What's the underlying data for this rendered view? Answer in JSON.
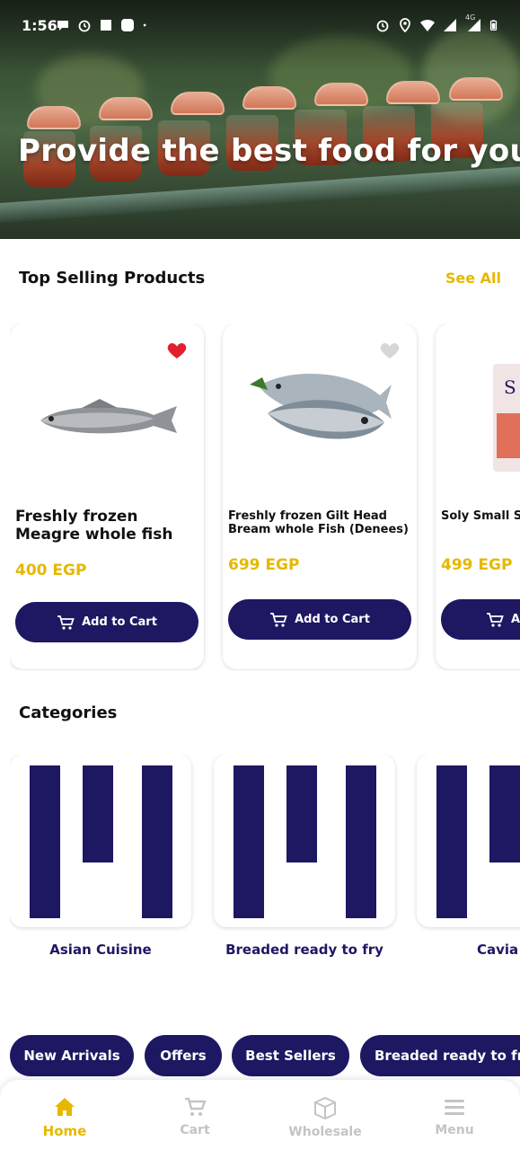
{
  "status_bar": {
    "time": "1:56",
    "network": "4G"
  },
  "hero": {
    "title": "Provide the best food for you"
  },
  "top_selling": {
    "title": "Top Selling Products",
    "see_all": "See All",
    "products": [
      {
        "name": "Freshly frozen Meagre whole fish",
        "price": "400 EGP",
        "favorite": true,
        "add_label": "Add to Cart"
      },
      {
        "name": "Freshly frozen Gilt Head Bream whole Fish (Denees)",
        "price": "699 EGP",
        "favorite": false,
        "add_label": "Add to Cart"
      },
      {
        "name": "Soly Small Sh Peeled and D",
        "price": "499 EGP",
        "favorite": false,
        "add_label": "Ad"
      }
    ]
  },
  "categories": {
    "title": "Categories",
    "items": [
      {
        "name": "Asian Cuisine"
      },
      {
        "name": "Breaded ready to fry"
      },
      {
        "name": "Cavia"
      }
    ]
  },
  "chips": [
    "New Arrivals",
    "Offers",
    "Best Sellers",
    "Breaded ready to fry"
  ],
  "bottom_nav": [
    {
      "label": "Home",
      "icon": "home-icon",
      "active": true
    },
    {
      "label": "Cart",
      "icon": "cart-icon",
      "active": false
    },
    {
      "label": "Wholesale",
      "icon": "box-icon",
      "active": false
    },
    {
      "label": "Menu",
      "icon": "menu-icon",
      "active": false
    }
  ],
  "colors": {
    "brand": "#1e1762",
    "accent": "#e6b800",
    "favorite": "#e0202f",
    "favorite_off": "#d6d6d6",
    "inactive": "#c4c4c4"
  }
}
